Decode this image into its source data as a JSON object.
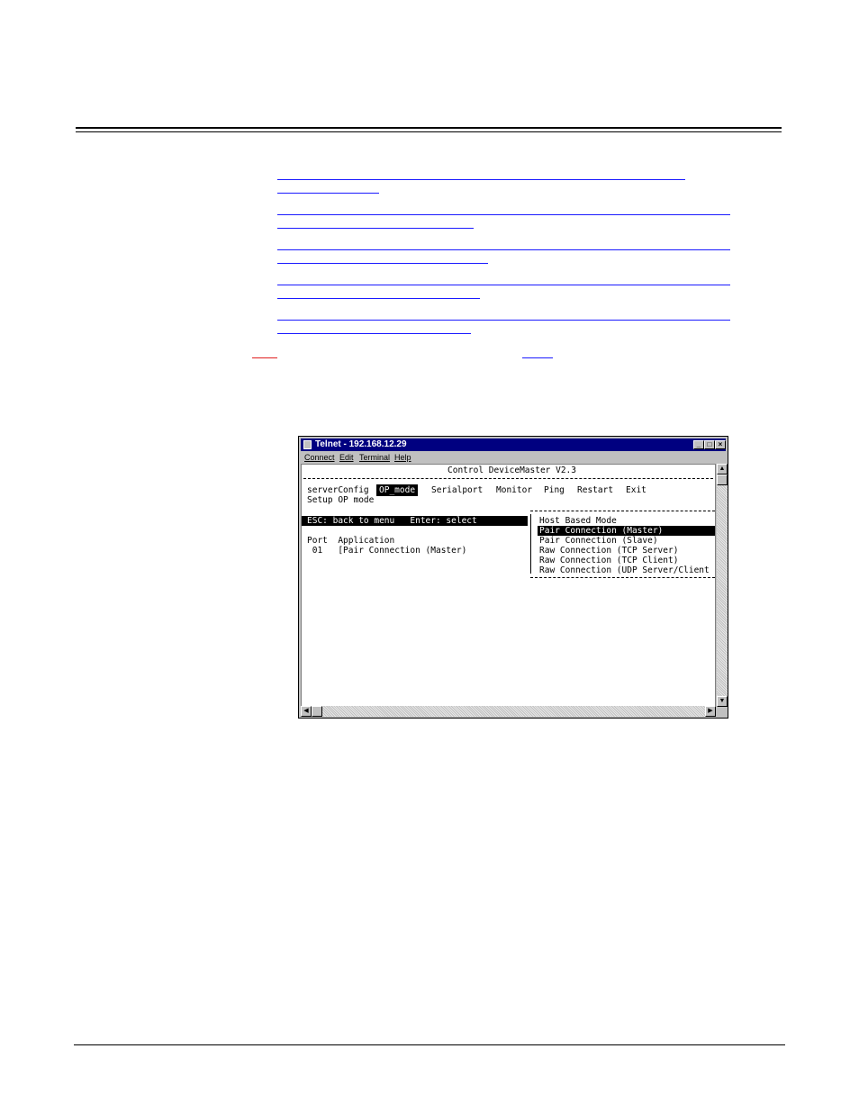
{
  "window": {
    "title": "Telnet - 192.168.12.29",
    "minimize_glyph": "_",
    "maximize_glyph": "□",
    "close_glyph": "×"
  },
  "menu": [
    "Connect",
    "Edit",
    "Terminal",
    "Help"
  ],
  "terminal": {
    "header": "Control DeviceMaster V2.3",
    "nav_items": [
      "serverConfig",
      "OP_mode",
      "Serialport",
      "Monitor",
      "Ping",
      "Restart",
      "Exit"
    ],
    "nav_selected": "OP_mode",
    "subtitle": "Setup OP mode",
    "help_bar": "ESC: back to menu   Enter: select",
    "table_header": "Port  Application",
    "table_row": " 01   [Pair Connection (Master)",
    "options": [
      "Host Based Mode",
      "Pair Connection (Master)",
      "Pair Connection (Slave)",
      "Raw Connection (TCP Server)",
      "Raw Connection (TCP Client)",
      "Raw Connection (UDP Server/Client"
    ],
    "selected_option": "Pair Connection (Master)"
  },
  "scroll_glyphs": {
    "up": "▲",
    "down": "▼",
    "left": "◀",
    "right": "▶"
  },
  "colors": {
    "titlebar": "#000080",
    "link": "#1a1aff",
    "red_mark": "#e02020"
  }
}
